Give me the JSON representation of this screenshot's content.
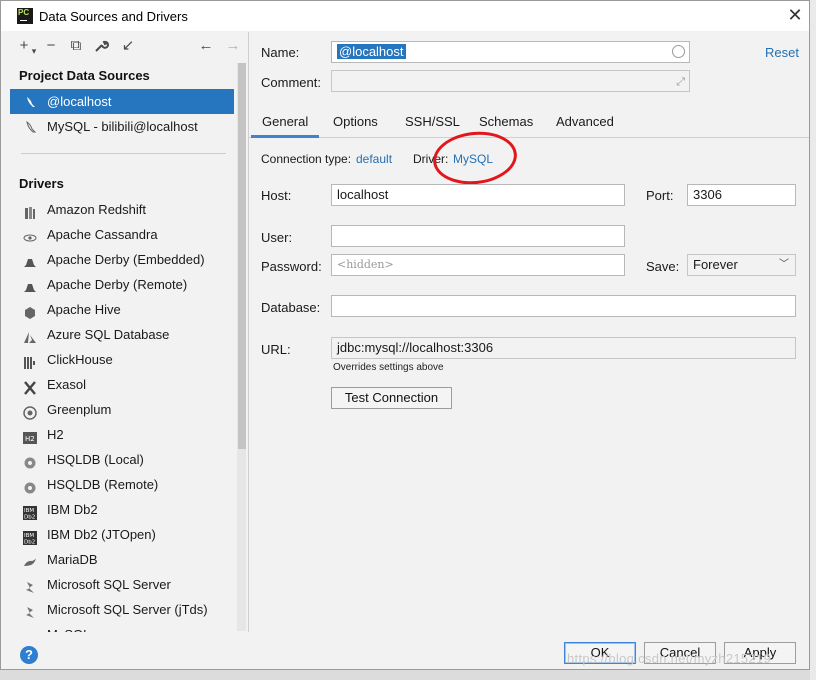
{
  "window": {
    "title": "Data Sources and Drivers",
    "app_icon_text": "PC",
    "close_glyph": "✕"
  },
  "toolbar": {
    "add": "+",
    "remove": "−",
    "copy": "⧉",
    "settings": "🔧",
    "import": "↙",
    "back": "←",
    "forward": "→"
  },
  "project_sources": {
    "heading": "Project Data Sources",
    "items": [
      {
        "label": "@localhost",
        "selected": true,
        "icon": "mysql-dolphin-icon"
      },
      {
        "label": "MySQL - bilibili@localhost",
        "selected": false,
        "icon": "mysql-dolphin-icon"
      }
    ]
  },
  "drivers": {
    "heading": "Drivers",
    "items": [
      {
        "label": "Amazon Redshift",
        "icon": "redshift-icon"
      },
      {
        "label": "Apache Cassandra",
        "icon": "cassandra-eye-icon"
      },
      {
        "label": "Apache Derby (Embedded)",
        "icon": "derby-hat-icon"
      },
      {
        "label": "Apache Derby (Remote)",
        "icon": "derby-hat-icon"
      },
      {
        "label": "Apache Hive",
        "icon": "hive-icon"
      },
      {
        "label": "Azure SQL Database",
        "icon": "azure-icon"
      },
      {
        "label": "ClickHouse",
        "icon": "clickhouse-bars-icon"
      },
      {
        "label": "Exasol",
        "icon": "exasol-x-icon"
      },
      {
        "label": "Greenplum",
        "icon": "greenplum-icon"
      },
      {
        "label": "H2",
        "icon": "h2-icon"
      },
      {
        "label": "HSQLDB (Local)",
        "icon": "hsqldb-icon"
      },
      {
        "label": "HSQLDB (Remote)",
        "icon": "hsqldb-icon"
      },
      {
        "label": "IBM Db2",
        "icon": "ibm-db2-icon"
      },
      {
        "label": "IBM Db2 (JTOpen)",
        "icon": "ibm-db2-icon"
      },
      {
        "label": "MariaDB",
        "icon": "mariadb-seal-icon"
      },
      {
        "label": "Microsoft SQL Server",
        "icon": "sqlserver-icon"
      },
      {
        "label": "Microsoft SQL Server (jTds)",
        "icon": "sqlserver-icon"
      },
      {
        "label": "MySQL",
        "icon": "mysql-dolphin-icon"
      }
    ]
  },
  "form": {
    "name_label": "Name:",
    "name_value": "@localhost",
    "comment_label": "Comment:",
    "comment_value": "",
    "reset": "Reset",
    "tabs": [
      "General",
      "Options",
      "SSH/SSL",
      "Schemas",
      "Advanced"
    ],
    "active_tab": "General",
    "connection_type_label": "Connection type:",
    "connection_type_value": "default",
    "driver_label": "Driver:",
    "driver_value": "MySQL",
    "host_label": "Host:",
    "host_value": "localhost",
    "port_label": "Port:",
    "port_value": "3306",
    "user_label": "User:",
    "user_value": "",
    "password_label": "Password:",
    "password_placeholder": "<hidden>",
    "save_label": "Save:",
    "save_value": "Forever",
    "database_label": "Database:",
    "database_value": "",
    "url_label": "URL:",
    "url_value": "jdbc:mysql://localhost:3306",
    "url_note": "Overrides settings above",
    "test_connection": "Test Connection"
  },
  "footer": {
    "help": "?",
    "ok": "OK",
    "cancel": "Cancel",
    "apply": "Apply",
    "watermark": "https://blog.csdn.net/myzh215219"
  },
  "colors": {
    "selection": "#2675bf",
    "link": "#2470b3",
    "annotation": "#e2161b"
  }
}
